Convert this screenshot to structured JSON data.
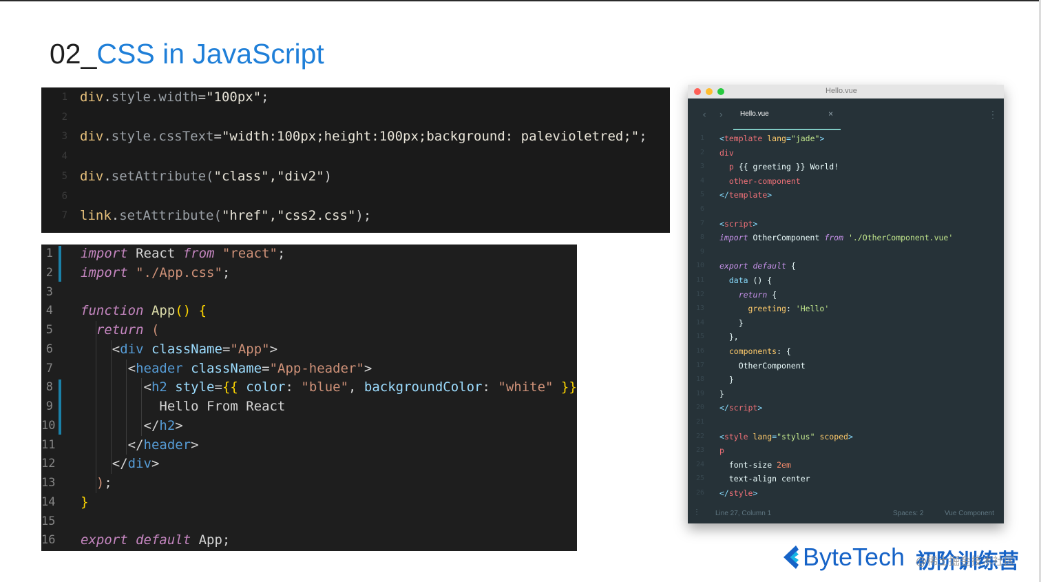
{
  "slide": {
    "title_num": "02_",
    "title_text": "CSS in JavaScript"
  },
  "panel1": {
    "lines": [
      {
        "n": "1",
        "obj": "div",
        "sep": ".",
        "mem": "style.width",
        "eq": "=",
        "str": "\"100px\"",
        "end": ";"
      },
      {
        "n": "2"
      },
      {
        "n": "3",
        "obj": "div",
        "sep": ".",
        "mem": "style.cssText",
        "eq": "=",
        "str": "\"width:100px;height:100px;background: palevioletred;\"",
        "end": ";"
      },
      {
        "n": "4"
      },
      {
        "n": "5",
        "obj": "div",
        "sep": ".",
        "mem": "setAttribute(",
        "eq": "",
        "str": "\"class\",\"div2\"",
        "end": ")"
      },
      {
        "n": "6"
      },
      {
        "n": "7",
        "obj": "link",
        "sep": ".",
        "mem": "setAttribute(",
        "eq": "",
        "str": "\"href\",\"css2.css\"",
        "end": ");"
      }
    ]
  },
  "panel2": {
    "lines": [
      {
        "n": "1",
        "parts": [
          [
            "kw",
            "import"
          ],
          [
            "idf",
            " React "
          ],
          [
            "kw",
            "from"
          ],
          [
            "str",
            " \"react\""
          ],
          [
            "idf",
            ";"
          ]
        ]
      },
      {
        "n": "2",
        "parts": [
          [
            "kw",
            "import"
          ],
          [
            "str",
            " \"./App.css\""
          ],
          [
            "idf",
            ";"
          ]
        ]
      },
      {
        "n": "3",
        "parts": []
      },
      {
        "n": "4",
        "parts": [
          [
            "kw",
            "function"
          ],
          [
            "fnn",
            " App"
          ],
          [
            "br",
            "()"
          ],
          [
            "idf",
            " "
          ],
          [
            "br",
            "{"
          ]
        ]
      },
      {
        "n": "5",
        "parts": [
          [
            "idf",
            "  "
          ],
          [
            "kw",
            "return"
          ],
          [
            "idf",
            " "
          ],
          [
            "str",
            "("
          ]
        ]
      },
      {
        "n": "6",
        "parts": [
          [
            "idf",
            "    "
          ],
          [
            "txt",
            "<"
          ],
          [
            "tag",
            "div"
          ],
          [
            "at",
            " className"
          ],
          [
            "txt",
            "="
          ],
          [
            "str",
            "\"App\""
          ],
          [
            "txt",
            ">"
          ]
        ]
      },
      {
        "n": "7",
        "parts": [
          [
            "idf",
            "      "
          ],
          [
            "txt",
            "<"
          ],
          [
            "tag",
            "header"
          ],
          [
            "at",
            " className"
          ],
          [
            "txt",
            "="
          ],
          [
            "str",
            "\"App-header\""
          ],
          [
            "txt",
            ">"
          ]
        ]
      },
      {
        "n": "8",
        "parts": [
          [
            "idf",
            "        "
          ],
          [
            "txt",
            "<"
          ],
          [
            "tag",
            "h2"
          ],
          [
            "at",
            " style"
          ],
          [
            "txt",
            "="
          ],
          [
            "br",
            "{{"
          ],
          [
            "at",
            " color"
          ],
          [
            "txt",
            ": "
          ],
          [
            "str",
            "\"blue\""
          ],
          [
            "txt",
            ", "
          ],
          [
            "at",
            "backgroundColor"
          ],
          [
            "txt",
            ": "
          ],
          [
            "str",
            "\"white\""
          ],
          [
            "br",
            " }}"
          ],
          [
            "txt",
            ">"
          ]
        ]
      },
      {
        "n": "9",
        "parts": [
          [
            "idf",
            "          "
          ],
          [
            "txt",
            "Hello From React"
          ]
        ]
      },
      {
        "n": "10",
        "parts": [
          [
            "idf",
            "        "
          ],
          [
            "txt",
            "</"
          ],
          [
            "tag",
            "h2"
          ],
          [
            "txt",
            ">"
          ]
        ]
      },
      {
        "n": "11",
        "parts": [
          [
            "idf",
            "      "
          ],
          [
            "txt",
            "</"
          ],
          [
            "tag",
            "header"
          ],
          [
            "txt",
            ">"
          ]
        ]
      },
      {
        "n": "12",
        "parts": [
          [
            "idf",
            "    "
          ],
          [
            "txt",
            "</"
          ],
          [
            "tag",
            "div"
          ],
          [
            "txt",
            ">"
          ]
        ]
      },
      {
        "n": "13",
        "parts": [
          [
            "idf",
            "  "
          ],
          [
            "str",
            ")"
          ],
          [
            "idf",
            ";"
          ]
        ]
      },
      {
        "n": "14",
        "parts": [
          [
            "br",
            "}"
          ]
        ]
      },
      {
        "n": "15",
        "parts": []
      },
      {
        "n": "16",
        "parts": [
          [
            "kw",
            "export"
          ],
          [
            "idf",
            " "
          ],
          [
            "kw",
            "default"
          ],
          [
            "idf",
            " App;"
          ]
        ]
      }
    ]
  },
  "panel3": {
    "window_title": "Hello.vue",
    "tab_label": "Hello.vue",
    "tab_close": "×",
    "nav_back": "‹",
    "nav_forward": "›",
    "menu_glyph": "⋮",
    "status_left": "Line 27, Column 1",
    "status_spaces": "Spaces: 2",
    "status_lang": "Vue Component",
    "lines": [
      {
        "n": "1",
        "parts": [
          [
            "vb",
            "<"
          ],
          [
            "vt",
            "template"
          ],
          [
            "vy",
            " lang"
          ],
          [
            "vb",
            "="
          ],
          [
            "vs",
            "\"jade\""
          ],
          [
            "vb",
            ">"
          ]
        ]
      },
      {
        "n": "2",
        "parts": [
          [
            "vt",
            "div"
          ]
        ]
      },
      {
        "n": "3",
        "parts": [
          [
            "vp",
            "  "
          ],
          [
            "vt",
            "p"
          ],
          [
            "vp",
            " {{ greeting }} World!"
          ]
        ]
      },
      {
        "n": "4",
        "parts": [
          [
            "vp",
            "  "
          ],
          [
            "vt",
            "other-component"
          ]
        ]
      },
      {
        "n": "5",
        "parts": [
          [
            "vb",
            "</"
          ],
          [
            "vt",
            "template"
          ],
          [
            "vb",
            ">"
          ]
        ]
      },
      {
        "n": "6",
        "parts": []
      },
      {
        "n": "7",
        "parts": [
          [
            "vb",
            "<"
          ],
          [
            "vt",
            "script"
          ],
          [
            "vb",
            ">"
          ]
        ]
      },
      {
        "n": "8",
        "parts": [
          [
            "vk",
            "import"
          ],
          [
            "vi",
            " OtherComponent "
          ],
          [
            "vk",
            "from"
          ],
          [
            "vs",
            " './OtherComponent.vue'"
          ]
        ]
      },
      {
        "n": "9",
        "parts": []
      },
      {
        "n": "10",
        "parts": [
          [
            "vk",
            "export default"
          ],
          [
            "vp",
            " {"
          ]
        ]
      },
      {
        "n": "11",
        "parts": [
          [
            "vp",
            "  "
          ],
          [
            "vb",
            "data"
          ],
          [
            "vp",
            " () {"
          ]
        ]
      },
      {
        "n": "12",
        "parts": [
          [
            "vp",
            "    "
          ],
          [
            "vk",
            "return"
          ],
          [
            "vp",
            " {"
          ]
        ]
      },
      {
        "n": "13",
        "parts": [
          [
            "vp",
            "      "
          ],
          [
            "vy",
            "greeting"
          ],
          [
            "vp",
            ": "
          ],
          [
            "vs",
            "'Hello'"
          ]
        ]
      },
      {
        "n": "14",
        "parts": [
          [
            "vp",
            "    }"
          ]
        ]
      },
      {
        "n": "15",
        "parts": [
          [
            "vp",
            "  },"
          ]
        ]
      },
      {
        "n": "16",
        "parts": [
          [
            "vp",
            "  "
          ],
          [
            "vy",
            "components"
          ],
          [
            "vp",
            ": {"
          ]
        ]
      },
      {
        "n": "17",
        "parts": [
          [
            "vp",
            "    OtherComponent"
          ]
        ]
      },
      {
        "n": "18",
        "parts": [
          [
            "vp",
            "  }"
          ]
        ]
      },
      {
        "n": "19",
        "parts": [
          [
            "vp",
            "}"
          ]
        ]
      },
      {
        "n": "20",
        "parts": [
          [
            "vb",
            "</"
          ],
          [
            "vt",
            "script"
          ],
          [
            "vb",
            ">"
          ]
        ]
      },
      {
        "n": "21",
        "parts": []
      },
      {
        "n": "22",
        "parts": [
          [
            "vb",
            "<"
          ],
          [
            "vt",
            "style"
          ],
          [
            "vy",
            " lang"
          ],
          [
            "vb",
            "="
          ],
          [
            "vs",
            "\"stylus\""
          ],
          [
            "vy",
            " scoped"
          ],
          [
            "vb",
            ">"
          ]
        ]
      },
      {
        "n": "23",
        "parts": [
          [
            "vt",
            "p"
          ]
        ]
      },
      {
        "n": "24",
        "parts": [
          [
            "vp",
            "  font-size "
          ],
          [
            "vo",
            "2em"
          ]
        ]
      },
      {
        "n": "25",
        "parts": [
          [
            "vp",
            "  text-align center"
          ]
        ]
      },
      {
        "n": "26",
        "parts": [
          [
            "vb",
            "</"
          ],
          [
            "vt",
            "style"
          ],
          [
            "vb",
            ">"
          ]
        ]
      }
    ]
  },
  "logo": {
    "brand": "ByteTech",
    "program": "初阶训练营"
  },
  "watermark": "@稀土掘金技术社区",
  "colors": {
    "title_accent": "#1f7fd8",
    "brand_blue": "#1663c7",
    "mac_red": "#ff5f56",
    "mac_yellow": "#ffbd2e",
    "mac_green": "#27c93f"
  }
}
